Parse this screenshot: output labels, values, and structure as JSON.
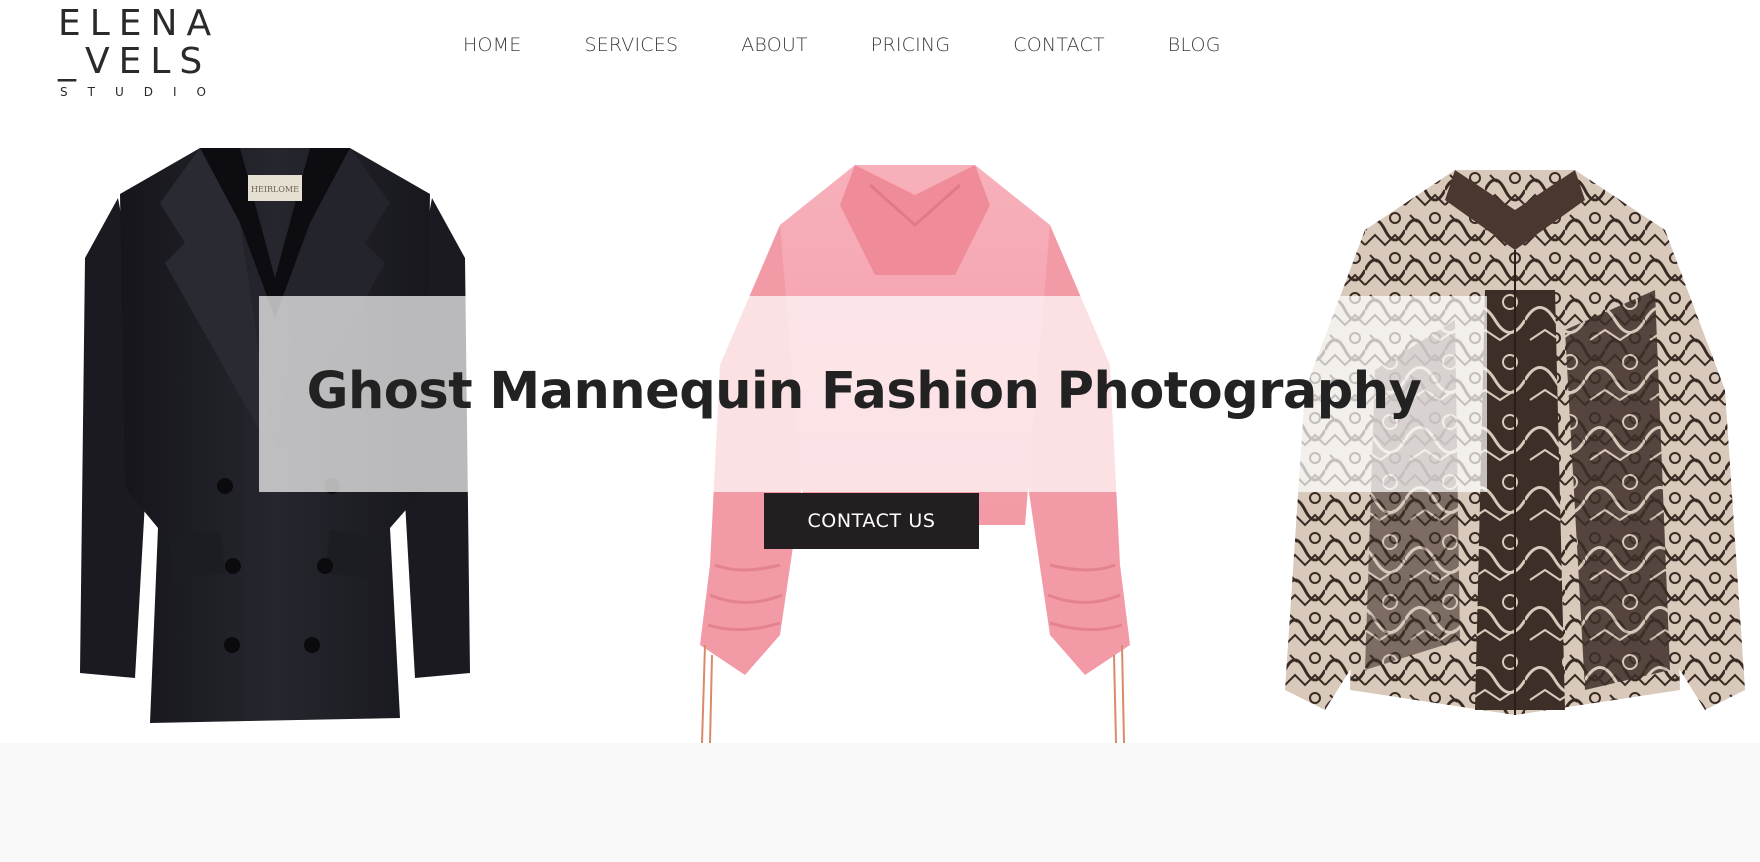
{
  "logo": {
    "line1": "ELENA",
    "line2": "_VELS",
    "line3": "STUDIO"
  },
  "nav": {
    "items": [
      {
        "label": "HOME"
      },
      {
        "label": "SERVICES"
      },
      {
        "label": "ABOUT"
      },
      {
        "label": "PRICING"
      },
      {
        "label": "CONTACT"
      },
      {
        "label": "BLOG"
      }
    ]
  },
  "hero": {
    "title": "Ghost Mannequin Fashion Photography",
    "cta_label": "CONTACT US",
    "blazer_tag": "HEIRLOME"
  },
  "colors": {
    "text": "#2a2a2a",
    "button_bg": "#231f20",
    "button_text": "#ffffff",
    "blazer": "#1f1f26",
    "top_pink": "#f4a3ae",
    "shirt_dark": "#3e2e28",
    "shirt_light": "#d9cbbd",
    "footer_bg": "#f9f9f9"
  }
}
